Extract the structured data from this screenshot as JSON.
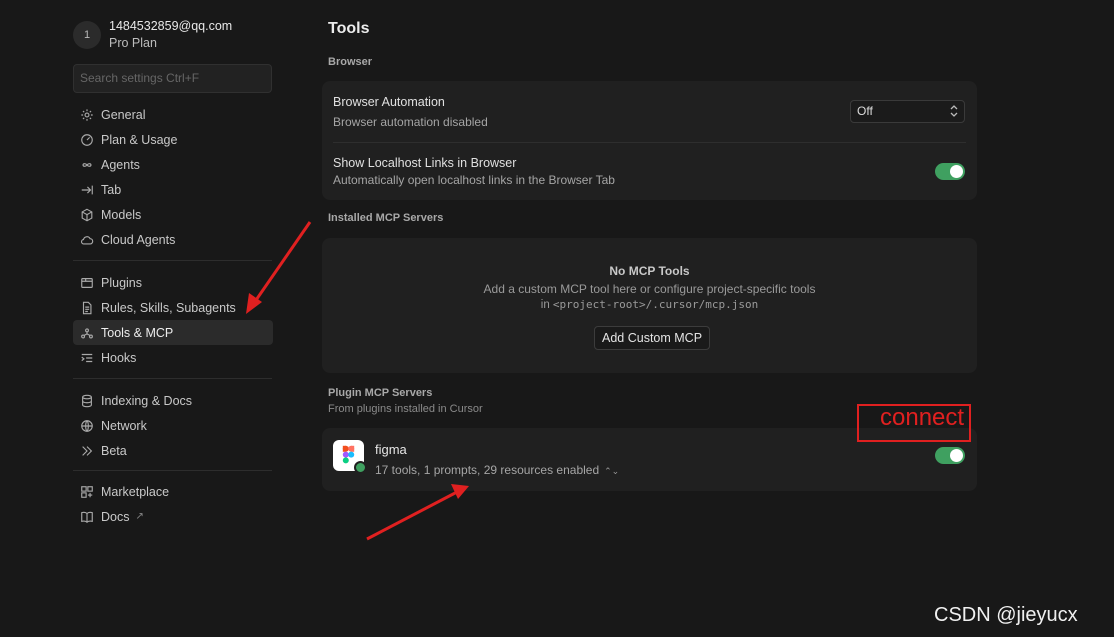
{
  "account": {
    "avatar_letter": "1",
    "email": "1484532859@qq.com",
    "plan": "Pro Plan"
  },
  "search": {
    "placeholder": "Search settings Ctrl+F"
  },
  "nav": {
    "group1": [
      {
        "label": "General",
        "icon": "gear-icon"
      },
      {
        "label": "Plan & Usage",
        "icon": "gauge-icon"
      },
      {
        "label": "Agents",
        "icon": "infinity-icon"
      },
      {
        "label": "Tab",
        "icon": "tab-arrow-icon"
      },
      {
        "label": "Models",
        "icon": "cube-icon"
      },
      {
        "label": "Cloud Agents",
        "icon": "cloud-icon"
      }
    ],
    "group2": [
      {
        "label": "Plugins",
        "icon": "package-icon"
      },
      {
        "label": "Rules, Skills, Subagents",
        "icon": "document-icon"
      },
      {
        "label": "Tools & MCP",
        "icon": "tools-icon",
        "active": true
      },
      {
        "label": "Hooks",
        "icon": "hooks-icon"
      }
    ],
    "group3": [
      {
        "label": "Indexing & Docs",
        "icon": "database-icon"
      },
      {
        "label": "Network",
        "icon": "globe-icon"
      },
      {
        "label": "Beta",
        "icon": "chevrons-right-icon"
      }
    ],
    "group4": [
      {
        "label": "Marketplace",
        "icon": "grid-plus-icon"
      },
      {
        "label": "Docs",
        "icon": "book-icon",
        "external": "↗"
      }
    ]
  },
  "main": {
    "title": "Tools",
    "browser": {
      "section_label": "Browser",
      "automation_title": "Browser Automation",
      "automation_desc": "Browser automation disabled",
      "automation_value": "Off",
      "localhost_title": "Show Localhost Links in Browser",
      "localhost_desc": "Automatically open localhost links in the Browser Tab",
      "localhost_enabled": true
    },
    "installed": {
      "section_label": "Installed MCP Servers",
      "empty_title": "No MCP Tools",
      "empty_desc": "Add a custom MCP tool here or configure project-specific tools",
      "empty_path_prefix": "in",
      "empty_path": "<project-root>/.cursor/mcp.json",
      "add_button": "Add Custom MCP"
    },
    "plugin": {
      "section_label": "Plugin MCP Servers",
      "section_sub": "From plugins installed in Cursor",
      "name": "figma",
      "desc": "17 tools, 1 prompts, 29 resources enabled",
      "enabled": true
    }
  },
  "annotation": {
    "label": "connect",
    "color": "#e02020"
  },
  "watermark": "CSDN @jieyucx",
  "colors": {
    "toggle_on": "#3fa060",
    "background": "#181818",
    "card": "#202020"
  }
}
